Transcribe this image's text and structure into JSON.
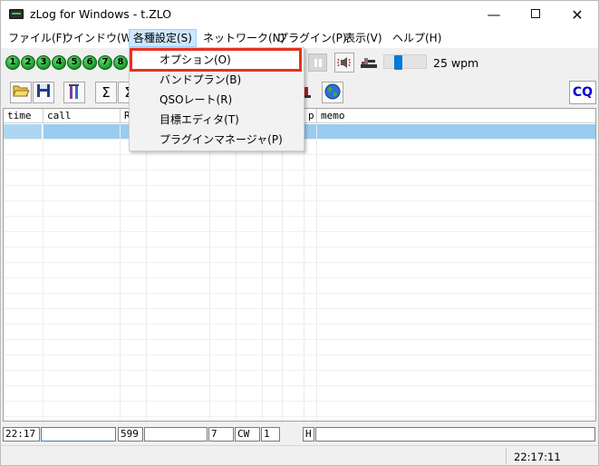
{
  "window": {
    "title": "zLog for Windows  - t.ZLO",
    "minimize": "—",
    "close": "✕"
  },
  "menubar": {
    "items": [
      {
        "label": "ファイル(F)"
      },
      {
        "label": "ウインドウ(W)"
      },
      {
        "label": "各種設定(S)"
      },
      {
        "label": "ネットワーク(N)"
      },
      {
        "label": "プラグイン(P)"
      },
      {
        "label": "表示(V)"
      },
      {
        "label": "ヘルプ(H)"
      }
    ]
  },
  "dropdown": {
    "items": [
      {
        "label": "オプション(O)"
      },
      {
        "label": "バンドプラン(B)"
      },
      {
        "label": "QSOレート(R)"
      },
      {
        "label": "目標エディタ(T)"
      },
      {
        "label": "プラグインマネージャ(P)"
      }
    ]
  },
  "toolbar1": {
    "number_keys": [
      "1",
      "2",
      "3",
      "4",
      "5",
      "6",
      "7",
      "8"
    ],
    "speed": "25 wpm",
    "speed_slider_level": 0.3
  },
  "toolbar2": {
    "sum_label": "Σ",
    "sum2_label": "Σ",
    "cq_label": "CQ"
  },
  "grid": {
    "columns": [
      {
        "label": "time"
      },
      {
        "label": "call"
      },
      {
        "label": "R"
      },
      {
        "label": ""
      },
      {
        "label": ""
      },
      {
        "label": ""
      },
      {
        "label": ""
      },
      {
        "label": ""
      },
      {
        "label": "p"
      },
      {
        "label": "memo"
      }
    ]
  },
  "entry": {
    "time": "22:17",
    "call": "",
    "rst": "599",
    "number": "",
    "band": "7",
    "mode": "CW",
    "power": "1",
    "field8": "",
    "op": "H",
    "memo": ""
  },
  "status": {
    "time": "22:17:11"
  },
  "colors": {
    "selection": "#99ccee",
    "highlight_border": "#e6321e",
    "cq_text": "#0000cc",
    "slider": "#0078d7"
  }
}
